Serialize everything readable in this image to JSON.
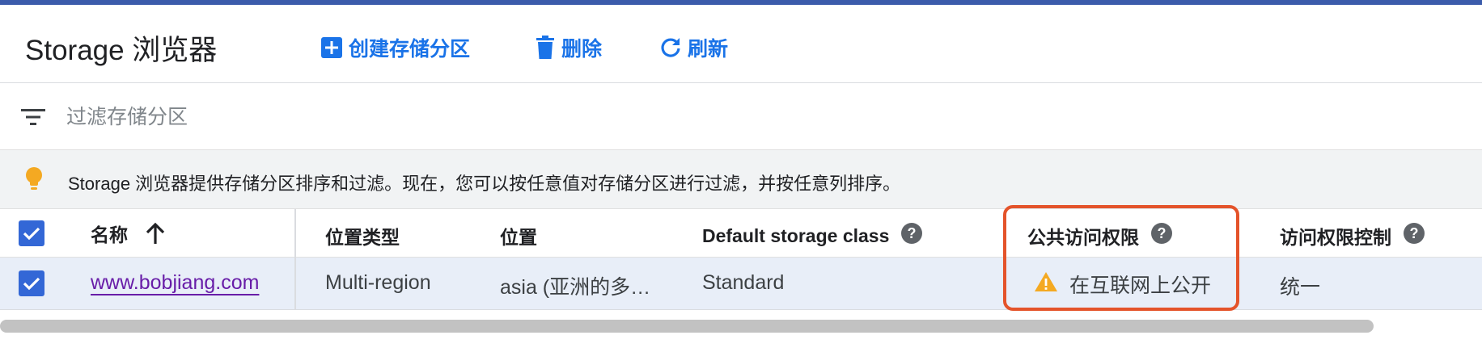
{
  "header": {
    "title": "Storage 浏览器",
    "create_label": "创建存储分区",
    "delete_label": "删除",
    "refresh_label": "刷新"
  },
  "filter": {
    "placeholder": "过滤存储分区",
    "value": ""
  },
  "tip": {
    "text": "Storage 浏览器提供存储分区排序和过滤。现在，您可以按任意值对存储分区进行过滤，并按任意列排序。"
  },
  "table": {
    "columns": {
      "name": "名称",
      "location_type": "位置类型",
      "location": "位置",
      "storage_class": "Default storage class",
      "public_access": "公共访问权限",
      "access_control": "访问权限控制"
    },
    "rows": [
      {
        "name": "www.bobjiang.com",
        "location_type": "Multi-region",
        "location": "asia (亚洲的多…",
        "storage_class": "Standard",
        "public_access": "在互联网上公开",
        "access_control": "统一"
      }
    ]
  },
  "colors": {
    "accent": "#1a73e8",
    "checkbox": "#3367d6",
    "topbar": "#3b5bab",
    "warning": "#f4a922",
    "highlight_border": "#e4532a",
    "link_visited": "#681da8"
  },
  "icons": {
    "create": "add-box-icon",
    "delete": "trash-icon",
    "refresh": "refresh-icon",
    "filter": "filter-list-icon",
    "tip": "lightbulb-icon",
    "sort": "arrow-up-icon",
    "help": "help-circle-icon",
    "warning": "warning-triangle-icon"
  }
}
